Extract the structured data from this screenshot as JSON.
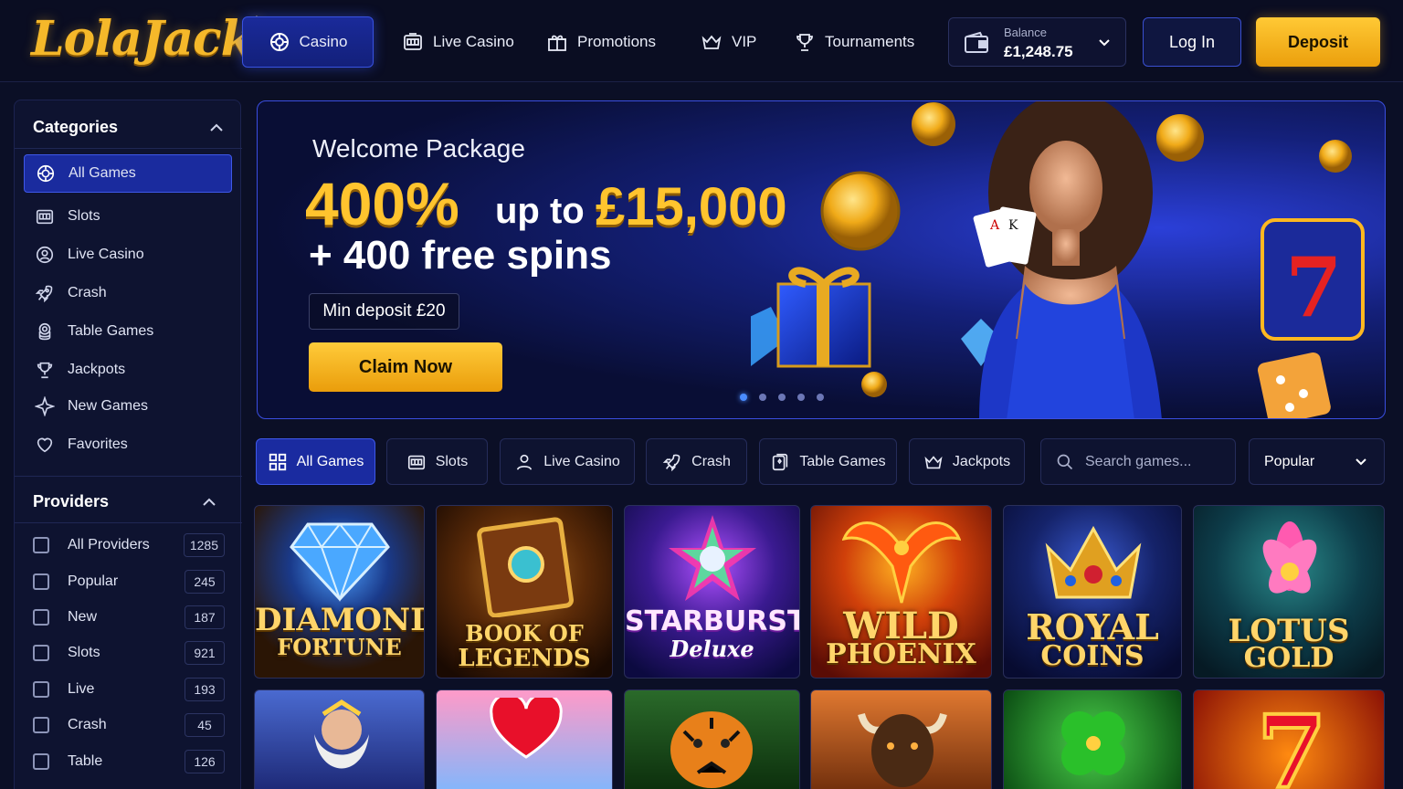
{
  "brand": {
    "logo_text": "LolaJack"
  },
  "nav": {
    "items": [
      {
        "label": "Casino",
        "icon": "chip-icon"
      },
      {
        "label": "Live Casino",
        "icon": "slot-machine-icon"
      },
      {
        "label": "Promotions",
        "icon": "gift-icon"
      },
      {
        "label": "VIP",
        "icon": "crown-icon"
      },
      {
        "label": "Tournaments",
        "icon": "trophy-icon"
      }
    ]
  },
  "balance": {
    "label": "Balance",
    "amount": "£1,248.75"
  },
  "auth": {
    "login_label": "Log In",
    "deposit_label": "Deposit"
  },
  "sidebar": {
    "categories_title": "Categories",
    "categories": [
      {
        "label": "All Games",
        "icon": "chip-icon"
      },
      {
        "label": "Slots",
        "icon": "slot-machine-icon"
      },
      {
        "label": "Live Casino",
        "icon": "dealer-icon"
      },
      {
        "label": "Crash",
        "icon": "rocket-icon"
      },
      {
        "label": "Table Games",
        "icon": "chip-stack-icon"
      },
      {
        "label": "Jackpots",
        "icon": "trophy-icon"
      },
      {
        "label": "New Games",
        "icon": "sparkle-icon"
      },
      {
        "label": "Favorites",
        "icon": "heart-icon"
      }
    ],
    "providers_title": "Providers",
    "providers": [
      {
        "label": "All Providers",
        "count": "1285"
      },
      {
        "label": "Popular",
        "count": "245"
      },
      {
        "label": "New",
        "count": "187"
      },
      {
        "label": "Slots",
        "count": "921"
      },
      {
        "label": "Live",
        "count": "193"
      },
      {
        "label": "Crash",
        "count": "45"
      },
      {
        "label": "Table",
        "count": "126"
      }
    ]
  },
  "banner": {
    "welcome": "Welcome Package",
    "percent": "400%",
    "up_to": "up to",
    "amount": "£15,000",
    "spins": "+ 400 free spins",
    "min_deposit": "Min deposit  £20",
    "cta": "Claim Now",
    "slide_count": 5,
    "active_slide": 1
  },
  "filters": {
    "tabs": [
      {
        "label": "All Games",
        "icon": "grid-icon"
      },
      {
        "label": "Slots",
        "icon": "slot-machine-icon"
      },
      {
        "label": "Live Casino",
        "icon": "person-icon"
      },
      {
        "label": "Crash",
        "icon": "rocket-icon"
      },
      {
        "label": "Table Games",
        "icon": "cards-icon"
      },
      {
        "label": "Jackpots",
        "icon": "crown-icon"
      }
    ],
    "search_placeholder": "Search games...",
    "sort_value": "Popular"
  },
  "games": [
    {
      "line1": "DIAMOND",
      "line2": "FORTUNE"
    },
    {
      "line1": "BOOK OF",
      "line2": "LEGENDS"
    },
    {
      "line1": "STARBURST",
      "line2": "Deluxe"
    },
    {
      "line1": "WILD",
      "line2": "PHOENIX"
    },
    {
      "line1": "ROYAL",
      "line2": "COINS"
    },
    {
      "line1": "LOTUS",
      "line2": "GOLD"
    },
    {
      "line1": "",
      "line2": ""
    },
    {
      "line1": "",
      "line2": ""
    },
    {
      "line1": "",
      "line2": ""
    },
    {
      "line1": "",
      "line2": ""
    },
    {
      "line1": "",
      "line2": ""
    },
    {
      "line1": "",
      "line2": ""
    }
  ],
  "colors": {
    "accent": "#1a2ba0",
    "gold": "#ffc42e",
    "background": "#0b0f26"
  }
}
